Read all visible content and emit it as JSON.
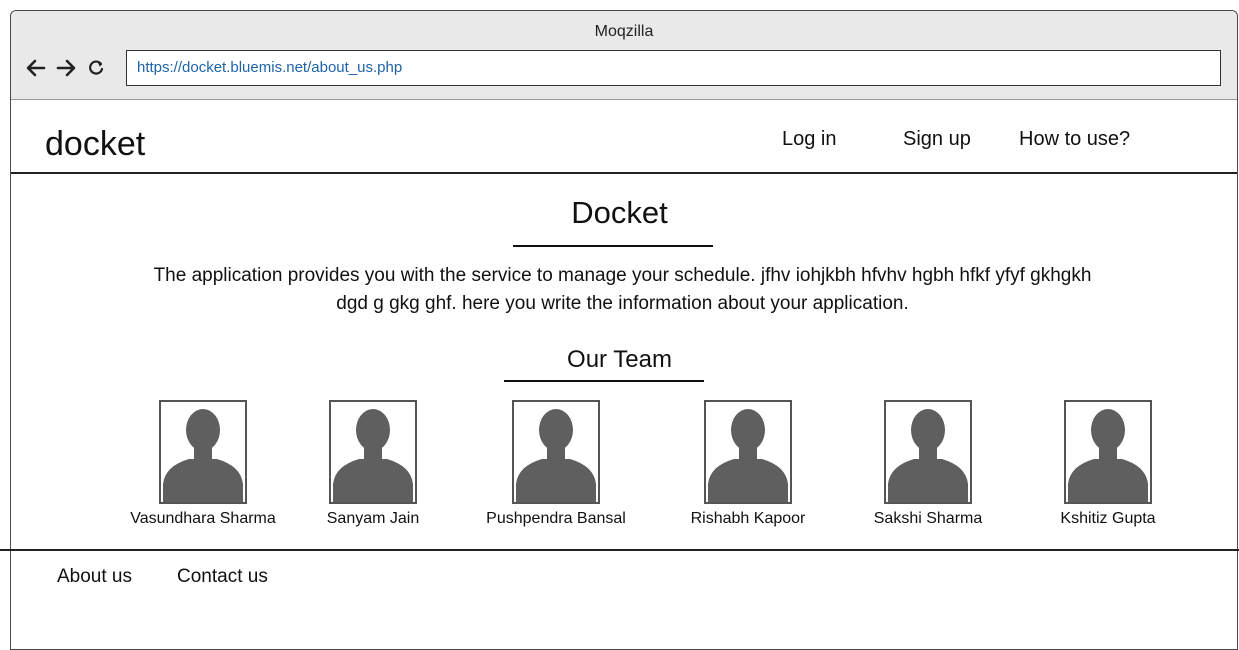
{
  "window": {
    "title": "Moqzilla"
  },
  "browser": {
    "url": "https://docket.bluemis.net/about_us.php",
    "back_icon": "arrow-left-icon",
    "forward_icon": "arrow-right-icon",
    "reload_icon": "reload-icon"
  },
  "header": {
    "logo": "docket",
    "nav": [
      "Log in",
      "Sign up",
      "How to use?"
    ]
  },
  "main": {
    "title": "Docket",
    "description": "The application provides you with the service to manage your schedule. jfhv iohjkbh hfvhv hgbh hfkf yfyf gkhgkh dgd g  gkg ghf. here you write the information about your application.",
    "team_title": "Our Team",
    "team": [
      {
        "name": "Vasundhara Sharma"
      },
      {
        "name": "Sanyam Jain"
      },
      {
        "name": "Pushpendra Bansal"
      },
      {
        "name": "Rishabh Kapoor"
      },
      {
        "name": "Sakshi Sharma"
      },
      {
        "name": "Kshitiz Gupta"
      }
    ]
  },
  "footer": {
    "links": [
      "About us",
      "Contact us"
    ]
  },
  "colors": {
    "url_text": "#1f63a8",
    "avatar_fill": "#5f5f5f",
    "titlebar": "#e9e9e9"
  }
}
